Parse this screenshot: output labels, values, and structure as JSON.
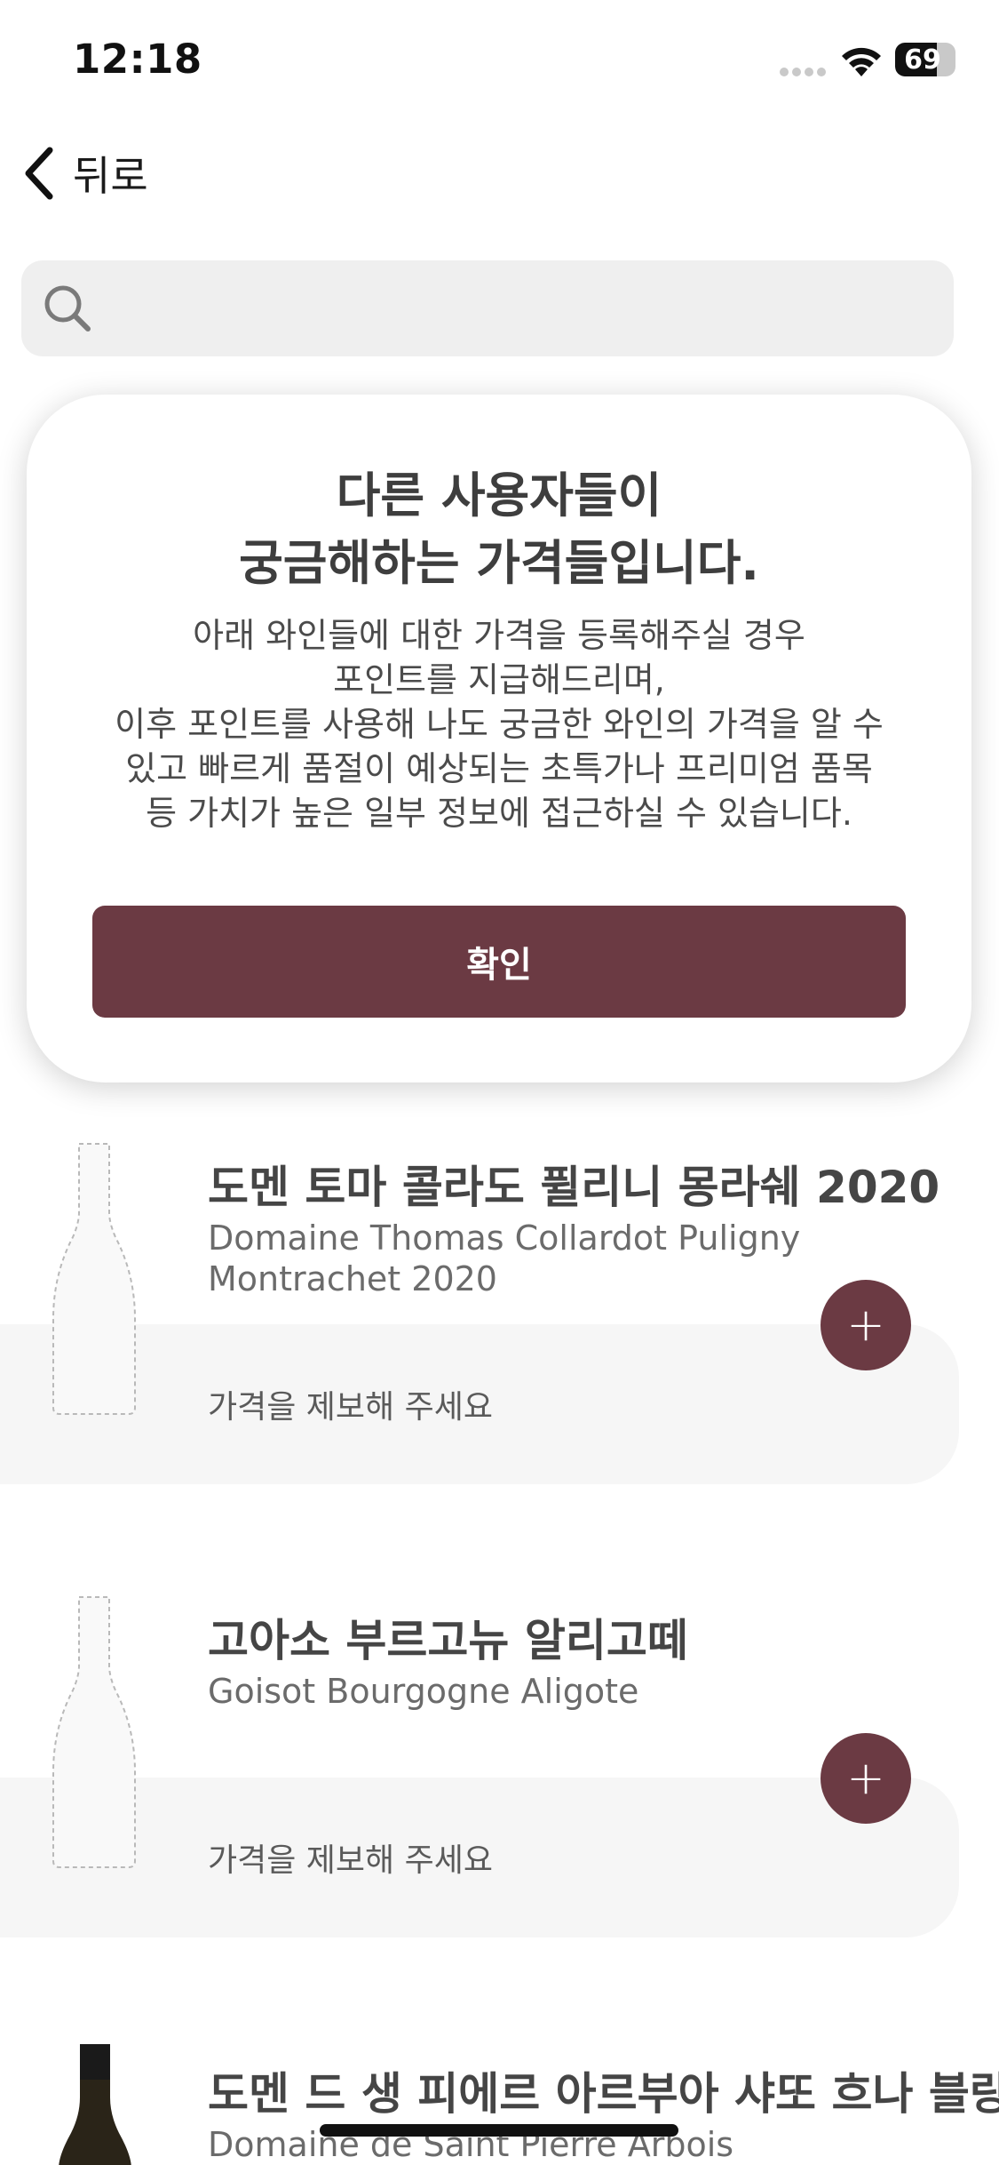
{
  "status_bar": {
    "time": "12:18",
    "battery": "69",
    "battery_level": 0.69
  },
  "nav": {
    "back_label": "뒤로"
  },
  "search": {
    "placeholder": ""
  },
  "modal": {
    "title_line1": "다른 사용자들이",
    "title_line2": "궁금해하는 가격들입니다.",
    "body_lines": [
      "아래 와인들에 대한 가격을 등록해주실 경우",
      "포인트를 지급해드리며,",
      "이후 포인트를 사용해 나도 궁금한 와인의 가격을 알 수",
      "있고 빠르게 품절이 예상되는 초특가나 프리미엄 품목",
      "등 가치가 높은 일부 정보에 접근하실 수 있습니다."
    ],
    "confirm_label": "확인"
  },
  "wines": [
    {
      "name_ko": "도멘 토마 콜라도 퓔리니 몽라쉐 2020",
      "name_en": "Domaine Thomas Collardot Puligny Montrachet 2020",
      "price_prompt": "가격을 제보해 주세요",
      "add_label": "+"
    },
    {
      "name_ko": "고아소 부르고뉴 알리고떼",
      "name_en": "Goisot Bourgogne Aligote",
      "price_prompt": "가격을 제보해 주세요",
      "add_label": "+"
    },
    {
      "name_ko": "도멘 드 생 피에르 아르부아 샤또 흐나 블랑",
      "name_en": "Domaine de Saint Pierre Arbois Chateau"
    }
  ],
  "colors": {
    "accent": "#6b3a43",
    "search_bg": "#efefef",
    "card_bg": "#f6f6f6"
  }
}
